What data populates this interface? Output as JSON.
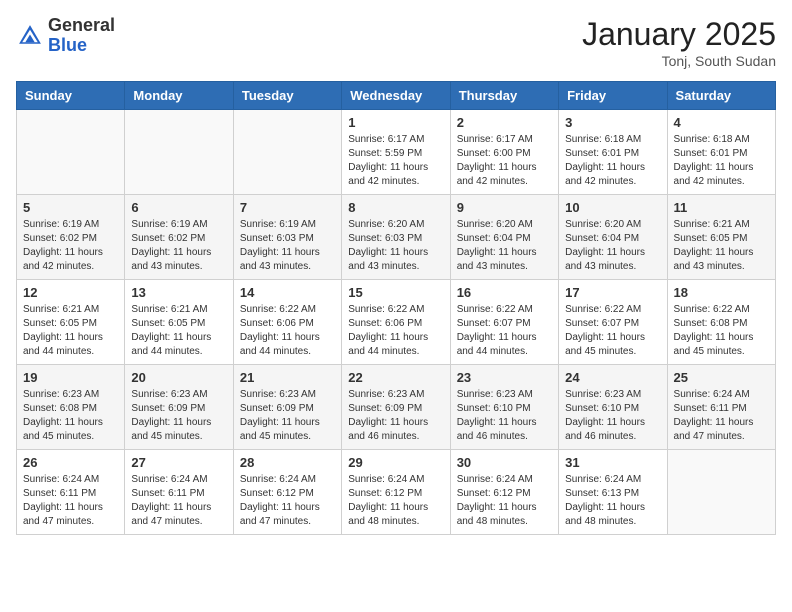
{
  "header": {
    "logo_general": "General",
    "logo_blue": "Blue",
    "month_title": "January 2025",
    "location": "Tonj, South Sudan"
  },
  "weekdays": [
    "Sunday",
    "Monday",
    "Tuesday",
    "Wednesday",
    "Thursday",
    "Friday",
    "Saturday"
  ],
  "weeks": [
    [
      {
        "day": "",
        "info": ""
      },
      {
        "day": "",
        "info": ""
      },
      {
        "day": "",
        "info": ""
      },
      {
        "day": "1",
        "info": "Sunrise: 6:17 AM\nSunset: 5:59 PM\nDaylight: 11 hours and 42 minutes."
      },
      {
        "day": "2",
        "info": "Sunrise: 6:17 AM\nSunset: 6:00 PM\nDaylight: 11 hours and 42 minutes."
      },
      {
        "day": "3",
        "info": "Sunrise: 6:18 AM\nSunset: 6:01 PM\nDaylight: 11 hours and 42 minutes."
      },
      {
        "day": "4",
        "info": "Sunrise: 6:18 AM\nSunset: 6:01 PM\nDaylight: 11 hours and 42 minutes."
      }
    ],
    [
      {
        "day": "5",
        "info": "Sunrise: 6:19 AM\nSunset: 6:02 PM\nDaylight: 11 hours and 42 minutes."
      },
      {
        "day": "6",
        "info": "Sunrise: 6:19 AM\nSunset: 6:02 PM\nDaylight: 11 hours and 43 minutes."
      },
      {
        "day": "7",
        "info": "Sunrise: 6:19 AM\nSunset: 6:03 PM\nDaylight: 11 hours and 43 minutes."
      },
      {
        "day": "8",
        "info": "Sunrise: 6:20 AM\nSunset: 6:03 PM\nDaylight: 11 hours and 43 minutes."
      },
      {
        "day": "9",
        "info": "Sunrise: 6:20 AM\nSunset: 6:04 PM\nDaylight: 11 hours and 43 minutes."
      },
      {
        "day": "10",
        "info": "Sunrise: 6:20 AM\nSunset: 6:04 PM\nDaylight: 11 hours and 43 minutes."
      },
      {
        "day": "11",
        "info": "Sunrise: 6:21 AM\nSunset: 6:05 PM\nDaylight: 11 hours and 43 minutes."
      }
    ],
    [
      {
        "day": "12",
        "info": "Sunrise: 6:21 AM\nSunset: 6:05 PM\nDaylight: 11 hours and 44 minutes."
      },
      {
        "day": "13",
        "info": "Sunrise: 6:21 AM\nSunset: 6:05 PM\nDaylight: 11 hours and 44 minutes."
      },
      {
        "day": "14",
        "info": "Sunrise: 6:22 AM\nSunset: 6:06 PM\nDaylight: 11 hours and 44 minutes."
      },
      {
        "day": "15",
        "info": "Sunrise: 6:22 AM\nSunset: 6:06 PM\nDaylight: 11 hours and 44 minutes."
      },
      {
        "day": "16",
        "info": "Sunrise: 6:22 AM\nSunset: 6:07 PM\nDaylight: 11 hours and 44 minutes."
      },
      {
        "day": "17",
        "info": "Sunrise: 6:22 AM\nSunset: 6:07 PM\nDaylight: 11 hours and 45 minutes."
      },
      {
        "day": "18",
        "info": "Sunrise: 6:22 AM\nSunset: 6:08 PM\nDaylight: 11 hours and 45 minutes."
      }
    ],
    [
      {
        "day": "19",
        "info": "Sunrise: 6:23 AM\nSunset: 6:08 PM\nDaylight: 11 hours and 45 minutes."
      },
      {
        "day": "20",
        "info": "Sunrise: 6:23 AM\nSunset: 6:09 PM\nDaylight: 11 hours and 45 minutes."
      },
      {
        "day": "21",
        "info": "Sunrise: 6:23 AM\nSunset: 6:09 PM\nDaylight: 11 hours and 45 minutes."
      },
      {
        "day": "22",
        "info": "Sunrise: 6:23 AM\nSunset: 6:09 PM\nDaylight: 11 hours and 46 minutes."
      },
      {
        "day": "23",
        "info": "Sunrise: 6:23 AM\nSunset: 6:10 PM\nDaylight: 11 hours and 46 minutes."
      },
      {
        "day": "24",
        "info": "Sunrise: 6:23 AM\nSunset: 6:10 PM\nDaylight: 11 hours and 46 minutes."
      },
      {
        "day": "25",
        "info": "Sunrise: 6:24 AM\nSunset: 6:11 PM\nDaylight: 11 hours and 47 minutes."
      }
    ],
    [
      {
        "day": "26",
        "info": "Sunrise: 6:24 AM\nSunset: 6:11 PM\nDaylight: 11 hours and 47 minutes."
      },
      {
        "day": "27",
        "info": "Sunrise: 6:24 AM\nSunset: 6:11 PM\nDaylight: 11 hours and 47 minutes."
      },
      {
        "day": "28",
        "info": "Sunrise: 6:24 AM\nSunset: 6:12 PM\nDaylight: 11 hours and 47 minutes."
      },
      {
        "day": "29",
        "info": "Sunrise: 6:24 AM\nSunset: 6:12 PM\nDaylight: 11 hours and 48 minutes."
      },
      {
        "day": "30",
        "info": "Sunrise: 6:24 AM\nSunset: 6:12 PM\nDaylight: 11 hours and 48 minutes."
      },
      {
        "day": "31",
        "info": "Sunrise: 6:24 AM\nSunset: 6:13 PM\nDaylight: 11 hours and 48 minutes."
      },
      {
        "day": "",
        "info": ""
      }
    ]
  ]
}
